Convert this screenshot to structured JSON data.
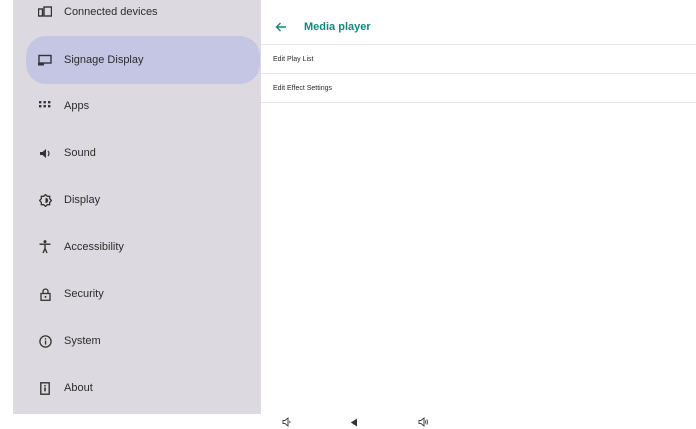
{
  "sidebar": {
    "items": [
      {
        "label": "Connected devices",
        "icon": "devices-icon"
      },
      {
        "label": "Signage Display",
        "icon": "signage-display-icon",
        "active": true
      },
      {
        "label": "Apps",
        "icon": "apps-grid-icon"
      },
      {
        "label": "Sound",
        "icon": "speaker-icon"
      },
      {
        "label": "Display",
        "icon": "brightness-icon"
      },
      {
        "label": "Accessibility",
        "icon": "accessibility-icon"
      },
      {
        "label": "Security",
        "icon": "lock-icon"
      },
      {
        "label": "System",
        "icon": "info-icon"
      },
      {
        "label": "About",
        "icon": "phone-icon"
      }
    ]
  },
  "main": {
    "title": "Media player",
    "items": [
      {
        "label": "Edit Play List"
      },
      {
        "label": "Edit Effect Settings"
      }
    ]
  },
  "colors": {
    "sidebar_bg": "#dcdae0",
    "active_bg": "#c4c6e4",
    "accent": "#0f8a7e"
  },
  "navbar": {
    "buttons": [
      "volume-down-icon",
      "back-triangle-icon",
      "volume-up-icon"
    ]
  }
}
